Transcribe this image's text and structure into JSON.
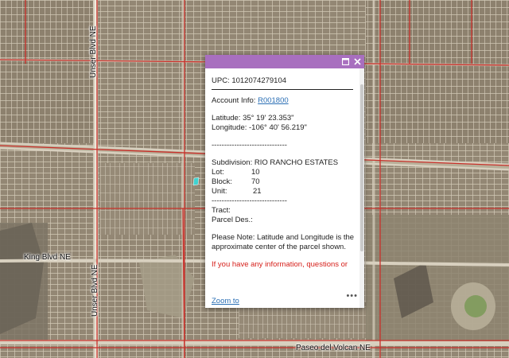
{
  "map": {
    "road_labels": {
      "top_vertical": "Unser Blvd NE",
      "bottom_vertical": "Unser Blvd NE",
      "left_horizontal": "King Blvd NE",
      "bottom_horizontal": "Paseo del Volcan NE"
    },
    "colors": {
      "terrain": "#8f8472",
      "parcel_line": "#efe7d7",
      "boundary": "#c8302a",
      "selected_parcel": "#3fd3d0"
    }
  },
  "popup": {
    "header_color": "#a86fbf",
    "maximize_icon": "maximize-icon",
    "close_icon": "close-icon",
    "upc_label": "UPC: 1012074279104",
    "account_label": "Account Info:",
    "account_link": "R001800",
    "latitude": "Latitude: 35° 19' 23.353\"",
    "longitude": "Longitude: -106° 40' 56.219\"",
    "dash_line": "------------------------------",
    "subdivision": "Subdivision: RIO RANCHO ESTATES",
    "lot_label": "Lot:",
    "lot_value": "10",
    "block_label": "Block:",
    "block_value": "70",
    "unit_label": "Unit:",
    "unit_value": "21",
    "tract_label": "Tract:",
    "parcel_des_label": "Parcel Des.:",
    "note_line1": "Please Note: Latitude and Longitude is the",
    "note_line2": "approximate center of the parcel shown.",
    "info_text": "If you have any information, questions or",
    "zoom_link": "Zoom to",
    "more_icon": "more-options-icon"
  }
}
